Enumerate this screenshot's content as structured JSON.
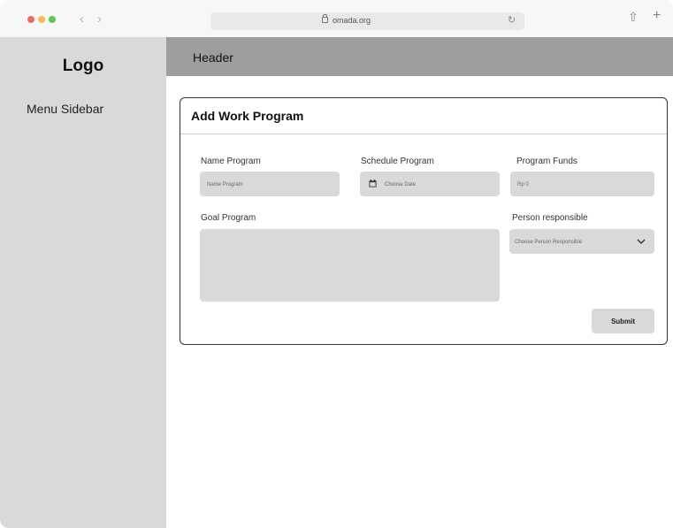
{
  "browser": {
    "url": "omada.org"
  },
  "sidebar": {
    "logo": "Logo",
    "menu_label": "Menu Sidebar"
  },
  "header": {
    "title": "Header"
  },
  "form": {
    "title": "Add Work Program",
    "name_program": {
      "label": "Name Program",
      "placeholder": "Name Program"
    },
    "schedule_program": {
      "label": "Schedule Program",
      "placeholder": "Choose Date"
    },
    "program_funds": {
      "label": "Program Funds",
      "placeholder": "Rp 0"
    },
    "goal_program": {
      "label": "Goal Program",
      "placeholder": ""
    },
    "person_responsible": {
      "label": "Person responsible",
      "selected": "Choose Person Responsible"
    },
    "submit_label": "Submit"
  },
  "icons": {
    "calendar": "calendar-icon",
    "dropdown": "chevron-down-icon",
    "lock": "lock-icon",
    "reload": "reload-icon",
    "share": "share-icon",
    "new_tab": "plus-icon"
  },
  "colors": {
    "sidebar_bg": "#d9d9d9",
    "header_bg": "#9e9e9e",
    "field_bg": "#d9d9d9",
    "traffic_red": "#ee6a5f",
    "traffic_yellow": "#f5be4f",
    "traffic_green": "#62c655"
  }
}
